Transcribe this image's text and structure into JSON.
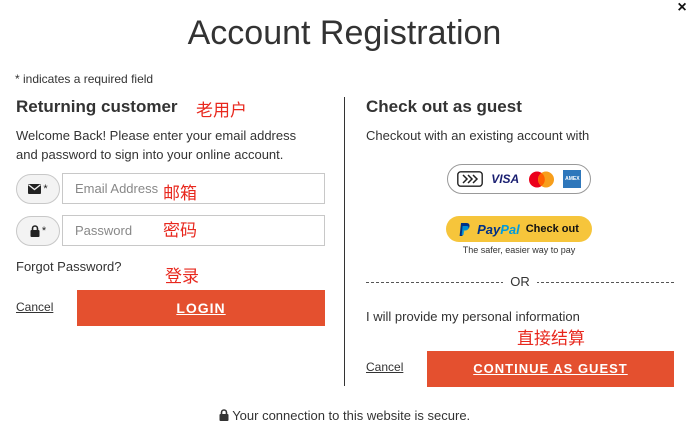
{
  "dialog": {
    "close_label": "×",
    "title": "Account Registration",
    "required_note": "* indicates a required field",
    "secure_note": "Your connection to this website is secure."
  },
  "returning": {
    "heading": "Returning customer",
    "heading_annotation": "老用户",
    "welcome": "Welcome Back! Please enter your email address and password to sign into your online account.",
    "email_icon_mark": "*",
    "email_placeholder": "Email Address",
    "email_annotation": "邮箱",
    "password_icon_mark": "*",
    "password_placeholder": "Password",
    "password_annotation": "密码",
    "forgot_label": "Forgot Password?",
    "login_annotation": "登录",
    "cancel_label": "Cancel",
    "login_label": "LOGIN"
  },
  "guest": {
    "heading": "Check out as guest",
    "existing_text": "Checkout with an existing account with",
    "cards": {
      "visa": "VISA",
      "amex": "AMEX"
    },
    "paypal": {
      "pay": "Pay",
      "pal": "Pal",
      "checkout": "Check out",
      "tagline": "The safer, easier way to pay"
    },
    "or_label": "OR",
    "provide_info": "I will provide my personal information",
    "direct_annotation": "直接结算",
    "cancel_label": "Cancel",
    "continue_label": "CONTINUE AS GUEST"
  },
  "colors": {
    "accent": "#e4502f",
    "annotation": "#e8281e",
    "paypal_yellow": "#f6c53b",
    "paypal_dark_blue": "#003087",
    "paypal_light_blue": "#009cde",
    "visa_blue": "#1a1f71",
    "mc_red": "#eb001b",
    "mc_orange": "#f79e1b",
    "amex_blue": "#2e77bb"
  },
  "icons": [
    "close-icon",
    "envelope-icon",
    "lock-icon",
    "card-link-icon",
    "mastercard-icon",
    "amex-icon",
    "paypal-p-icon",
    "padlock-icon"
  ]
}
